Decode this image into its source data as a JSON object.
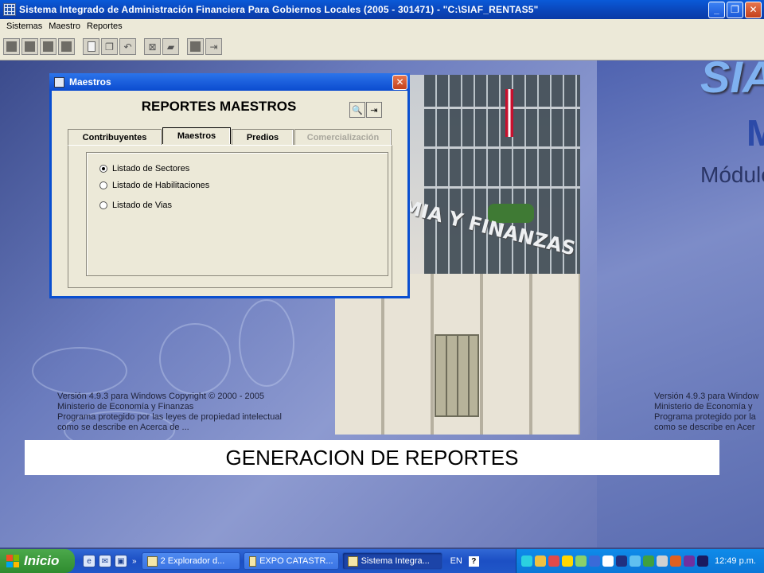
{
  "window": {
    "title": "Sistema Integrado de Administración Financiera Para Gobiernos Locales (2005 - 301471) - \"C:\\SIAF_RENTAS5\"",
    "minimize": "_",
    "maximize": "❐",
    "close": "✕"
  },
  "menu": {
    "items": [
      "Sistemas",
      "Maestro",
      "Reportes"
    ]
  },
  "background": {
    "sign": "OMIA Y FINANZAS",
    "logo": "SIAF",
    "m_letter": "M",
    "modulo": "Módulo",
    "copyright_left": "Versión 4.9.3 para Windows Copyright © 2000 - 2005\nMinisterio de Economía y Finanzas\nPrograma protegido por las leyes de propiedad intelectual\ncomo se describe en Acerca de ...",
    "copyright_right": "Versión 4.9.3 para Window\nMinisterio de Economía y\nPrograma protegido por la\ncomo se describe en Acer"
  },
  "dialog": {
    "title": "Maestros",
    "heading": "REPORTES MAESTROS",
    "close": "✕",
    "tabs": [
      {
        "label": "Contribuyentes",
        "state": "normal"
      },
      {
        "label": "Maestros",
        "state": "active"
      },
      {
        "label": "Predios",
        "state": "normal"
      },
      {
        "label": "Comercialización",
        "state": "disabled"
      }
    ],
    "options": [
      {
        "label": "Listado de Sectores",
        "selected": true
      },
      {
        "label": "Listado de Habilitaciones",
        "selected": false
      },
      {
        "label": "Listado de Vias",
        "selected": false
      }
    ]
  },
  "caption": "GENERACION DE REPORTES",
  "taskbar": {
    "start": "Inicio",
    "chevron": "»",
    "tasks": [
      {
        "label": "2 Explorador d...",
        "active": false
      },
      {
        "label": "EXPO CATASTR...",
        "active": false
      },
      {
        "label": "Sistema Integra...",
        "active": true
      }
    ],
    "language": "EN",
    "help": "?",
    "clock": "12:49 p.m."
  },
  "colors": {
    "titlebar": "#0a4fd0",
    "dialog_bg": "#ece9d8",
    "taskbar": "#2057c8",
    "start": "#2f8c2f",
    "tray": "#0b77d8"
  }
}
